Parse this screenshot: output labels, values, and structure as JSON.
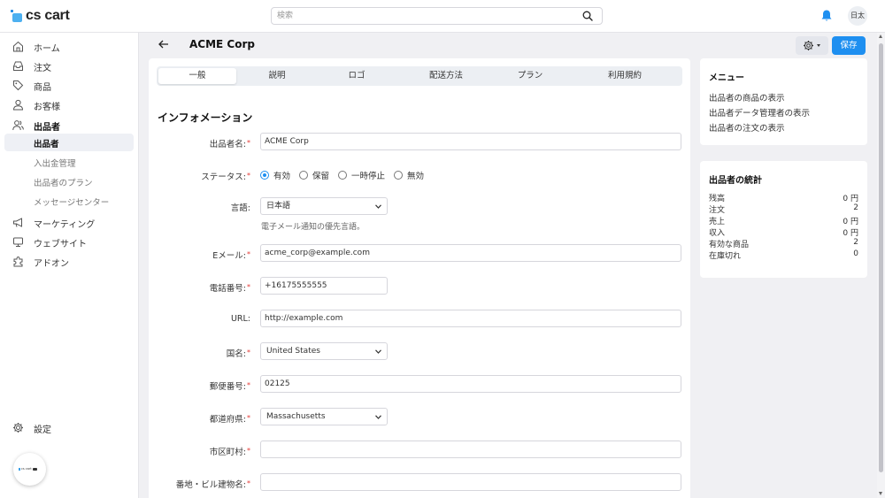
{
  "app": {
    "logo_text": "cs cart",
    "search_placeholder": "検索",
    "language_label": "日太",
    "icon_search": "search-icon",
    "icon_notifications": "bell-icon",
    "accent_color": "#1e8ff0"
  },
  "sidebar": {
    "items": [
      {
        "label": "ホーム",
        "icon": "home-icon"
      },
      {
        "label": "注文",
        "icon": "inbox-icon"
      },
      {
        "label": "商品",
        "icon": "tag-icon"
      },
      {
        "label": "お客様",
        "icon": "user-icon"
      },
      {
        "label": "出品者",
        "icon": "users-icon"
      },
      {
        "label": "マーケティング",
        "icon": "megaphone-icon"
      },
      {
        "label": "ウェブサイト",
        "icon": "monitor-icon"
      },
      {
        "label": "アドオン",
        "icon": "puzzle-icon"
      },
      {
        "label": "設定",
        "icon": "gear-icon"
      }
    ],
    "vendor_submenu": [
      "出品者",
      "入出金管理",
      "出品者のプラン",
      "メッセージセンター"
    ],
    "badge_text": "cs cart"
  },
  "header": {
    "title": "ACME Corp",
    "save_label": "保存"
  },
  "tabs": [
    "一般",
    "説明",
    "ロゴ",
    "配送方法",
    "プラン",
    "利用規約"
  ],
  "form": {
    "section_title": "インフォメーション",
    "vendor_name_label": "出品者名:",
    "vendor_name_value": "ACME Corp",
    "status_label": "ステータス:",
    "status_options": [
      "有効",
      "保留",
      "一時停止",
      "無効"
    ],
    "language_label": "言語:",
    "language_value": "日本語",
    "language_help": "電子メール通知の優先言語。",
    "email_label": "Eメール:",
    "email_value": "acme_corp@example.com",
    "phone_label": "電話番号:",
    "phone_value": "+16175555555",
    "url_label": "URL:",
    "url_value": "http://example.com",
    "country_label": "国名:",
    "country_value": "United States",
    "zip_label": "郵便番号:",
    "zip_value": "02125",
    "state_label": "都道府県:",
    "state_value": "Massachusetts",
    "city_label": "市区町村:",
    "city_value": "",
    "address_label": "番地・ビル建物名:",
    "address_value": "",
    "required_mark": "*"
  },
  "menu_panel": {
    "title": "メニュー",
    "links": [
      "出品者の商品の表示",
      "出品者データ管理者の表示",
      "出品者の注文の表示"
    ]
  },
  "stats_panel": {
    "title": "出品者の統計",
    "rows": [
      {
        "label": "残高",
        "value": "0 円"
      },
      {
        "label": "注文",
        "value": "2"
      },
      {
        "label": "売上",
        "value": "0 円"
      },
      {
        "label": "収入",
        "value": "0 円"
      },
      {
        "label": "有効な商品",
        "value": "2"
      },
      {
        "label": "在庫切れ",
        "value": "0"
      }
    ]
  }
}
